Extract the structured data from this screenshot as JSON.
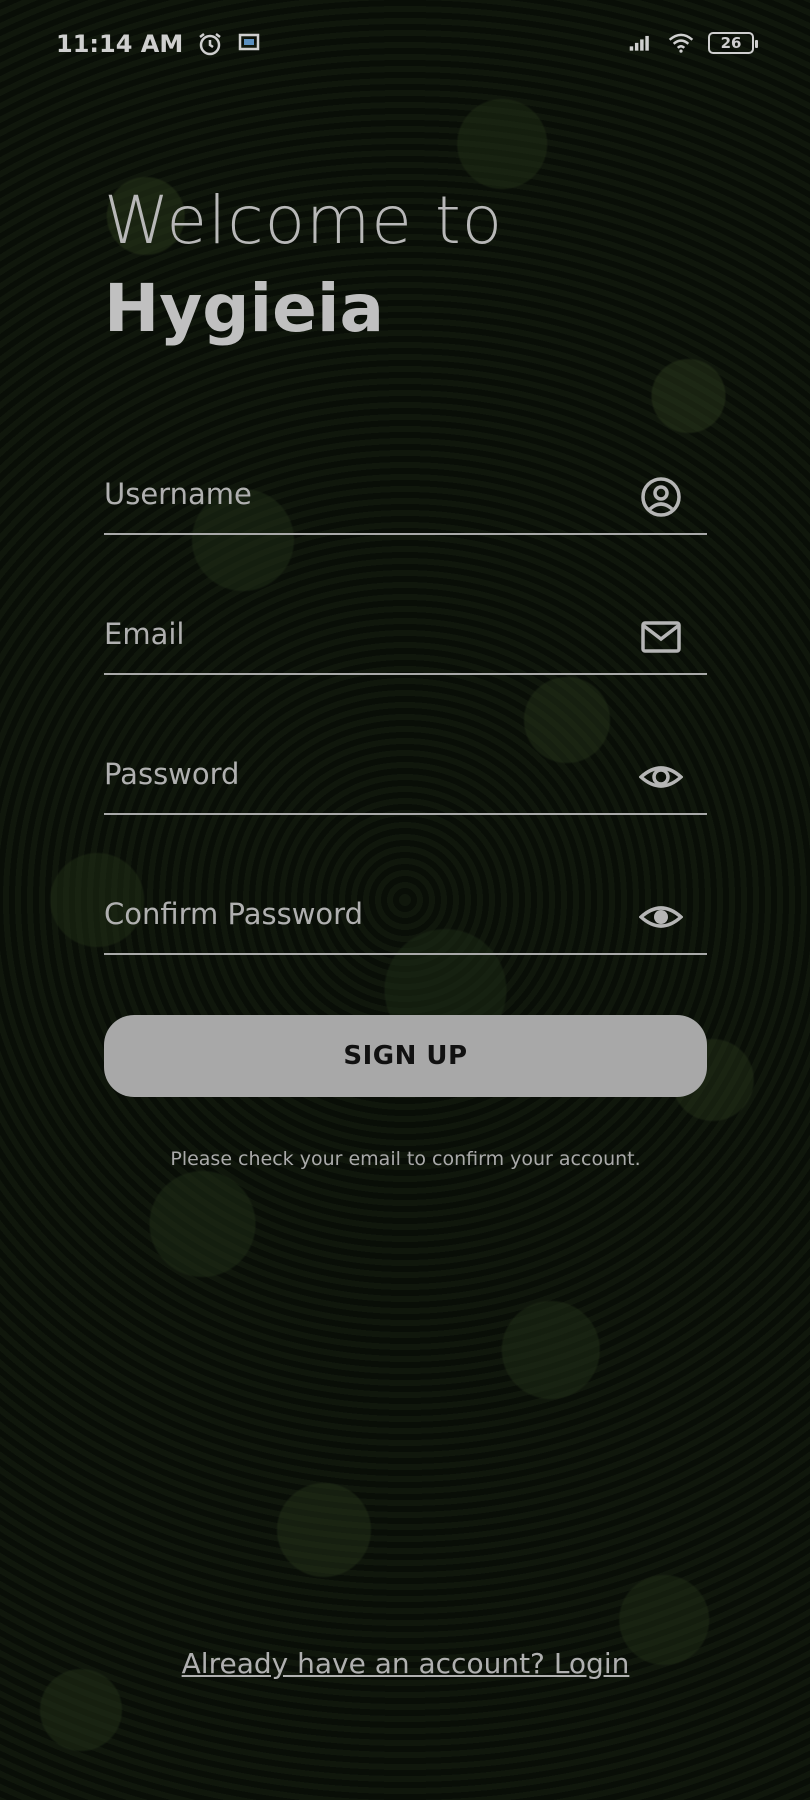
{
  "status_bar": {
    "time": "11:14 AM",
    "left_icons": [
      "alarm-icon",
      "screen-icon"
    ],
    "right_icons": [
      "signal-icon",
      "wifi-icon"
    ],
    "battery": "26"
  },
  "header": {
    "welcome": "Welcome to",
    "app_name": "Hygieia"
  },
  "form": {
    "username": {
      "placeholder": "Username",
      "icon": "account-circle-icon"
    },
    "email": {
      "placeholder": "Email",
      "icon": "mail-icon"
    },
    "password": {
      "placeholder": "Password",
      "icon": "eye-icon"
    },
    "confirm_password": {
      "placeholder": "Confirm Password",
      "icon": "eye-icon"
    },
    "signup_label": "SIGN UP",
    "notice": "Please check your email to confirm your account."
  },
  "footer": {
    "login_link": "Already have an account? Login"
  }
}
